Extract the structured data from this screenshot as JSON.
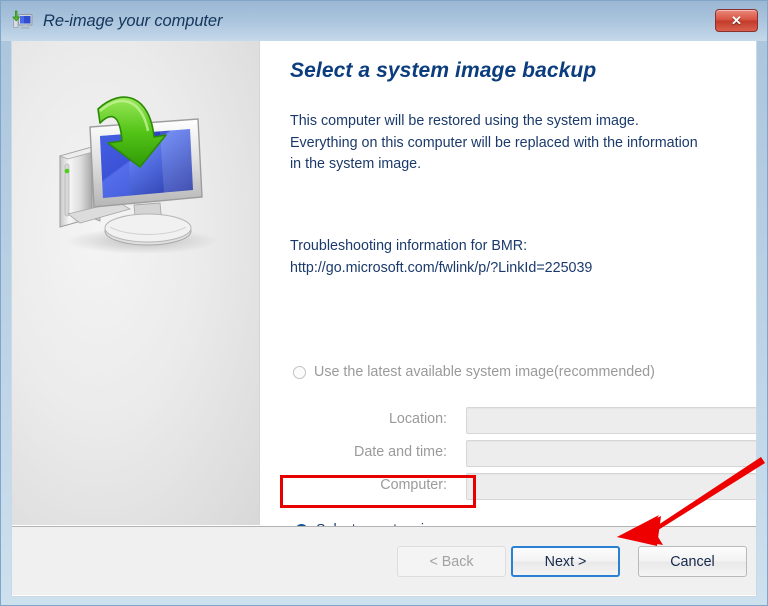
{
  "window": {
    "title": "Re-image your computer",
    "title_icon": "computer-restore-icon",
    "close_label": "✕"
  },
  "illustration": {
    "name": "computer-restore-illustration",
    "description": "Monitor with blue screen, green down arrow, and external hard drive"
  },
  "content": {
    "heading": "Select a system image backup",
    "paragraph": "This computer will be restored using the system image. Everything on this computer will be replaced with the information in the system image.",
    "troubleshooting_label": "Troubleshooting information for BMR:",
    "troubleshooting_url": "http://go.microsoft.com/fwlink/p/?LinkId=225039"
  },
  "options": [
    {
      "id": "use-latest-image",
      "label": "Use the latest available system image(recommended)",
      "selected": false,
      "disabled": true
    },
    {
      "id": "select-system-image",
      "label": "Select a system image",
      "selected": true,
      "disabled": false
    }
  ],
  "fields": [
    {
      "id": "location",
      "label": "Location:",
      "value": "",
      "disabled": true
    },
    {
      "id": "date-time",
      "label": "Date and time:",
      "value": "",
      "disabled": true
    },
    {
      "id": "computer",
      "label": "Computer:",
      "value": "",
      "disabled": true
    }
  ],
  "footer": {
    "back_label": "< Back",
    "next_label": "Next >",
    "cancel_label": "Cancel"
  },
  "annotations": {
    "highlight_color": "#e60000",
    "arrow_color": "#ee0000",
    "highlight_target": "select-system-image",
    "arrow_target": "next-button"
  }
}
